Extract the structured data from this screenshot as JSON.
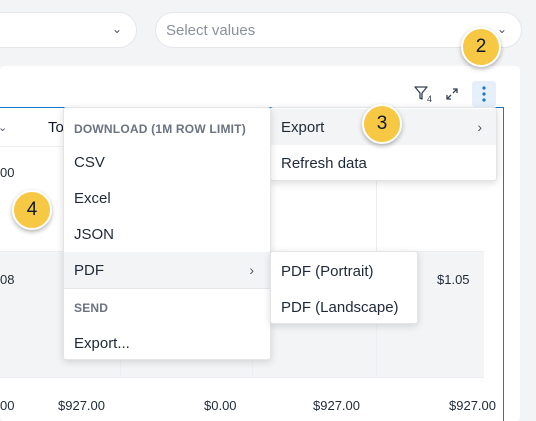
{
  "filters": {
    "left": {
      "chevron": "⌄"
    },
    "right": {
      "placeholder": "Select values",
      "chevron": "⌄"
    }
  },
  "table": {
    "header_col1_partial": "To",
    "row_top_partial": [
      "00"
    ],
    "row_mid_partial": [
      "08",
      "$1.05"
    ],
    "row_bottom": [
      "00",
      "$927.00",
      "$0.00",
      "$927.00",
      "$927.00"
    ]
  },
  "toolbar": {
    "filter_count": "4",
    "icons": [
      "filter-icon",
      "expand-icon",
      "kebab-menu-icon"
    ]
  },
  "chart_menu": {
    "export_label": "Export",
    "refresh_label": "Refresh data"
  },
  "export_menu": {
    "download_header": "DOWNLOAD (1M ROW LIMIT)",
    "csv": "CSV",
    "excel": "Excel",
    "json": "JSON",
    "pdf": "PDF",
    "send_header": "SEND",
    "export_dots": "Export..."
  },
  "pdf_menu": {
    "portrait": "PDF (Portrait)",
    "landscape": "PDF (Landscape)"
  },
  "badges": {
    "b2": "2",
    "b3": "3",
    "b4": "4"
  },
  "colors": {
    "accent": "#1877c9",
    "badge": "#f7c843"
  }
}
